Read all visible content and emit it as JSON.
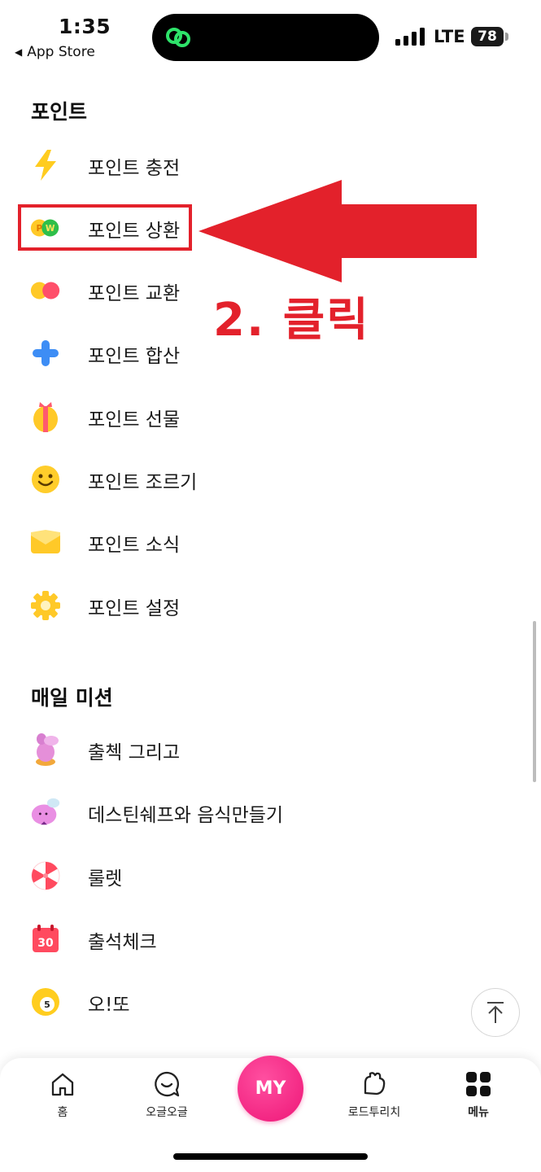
{
  "status_bar": {
    "time": "1:35",
    "back_label": "App Store",
    "network": "LTE",
    "battery": "78"
  },
  "sections": {
    "points": {
      "title": "포인트",
      "items": [
        {
          "label": "포인트 충전",
          "icon": "lightning-icon"
        },
        {
          "label": "포인트 상환",
          "icon": "pw-coins-icon"
        },
        {
          "label": "포인트 교환",
          "icon": "two-coins-icon"
        },
        {
          "label": "포인트 합산",
          "icon": "plus-icon"
        },
        {
          "label": "포인트 선물",
          "icon": "gift-icon"
        },
        {
          "label": "포인트 조르기",
          "icon": "smile-icon"
        },
        {
          "label": "포인트 소식",
          "icon": "envelope-icon"
        },
        {
          "label": "포인트 설정",
          "icon": "gear-icon"
        }
      ]
    },
    "daily_mission": {
      "title": "매일 미션",
      "items": [
        {
          "label": "출첵 그리고",
          "icon": "character-icon"
        },
        {
          "label": "데스틴쉐프와 음식만들기",
          "icon": "chef-character-icon"
        },
        {
          "label": "룰렛",
          "icon": "roulette-icon"
        },
        {
          "label": "출석체크",
          "icon": "calendar-icon",
          "badge": "30"
        },
        {
          "label": "오!또",
          "icon": "lotto-ball-icon",
          "badge": "5"
        }
      ]
    }
  },
  "annotation": {
    "text": "2. 클릭",
    "color": "#e3212b"
  },
  "bottom_nav": {
    "items": [
      {
        "label": "홈",
        "icon": "home-icon"
      },
      {
        "label": "오글오글",
        "icon": "chat-icon"
      },
      {
        "label": "MY",
        "icon": "my-button"
      },
      {
        "label": "로드투리치",
        "icon": "hand-icon"
      },
      {
        "label": "메뉴",
        "icon": "grid-menu-icon"
      }
    ],
    "accent": "#ee1677"
  }
}
